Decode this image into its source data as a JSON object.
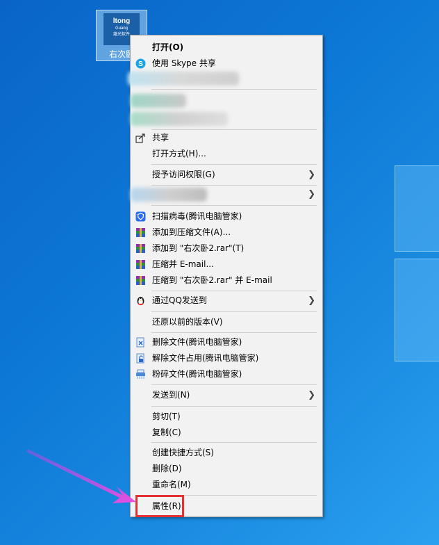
{
  "desktop": {
    "icon_label": "右次卧",
    "icon_logo_title": "ltong",
    "icon_logo_sub": "Guang",
    "icon_logo_tag": "蔻光软件"
  },
  "menu": {
    "open": "打开(O)",
    "skype_share": "使用 Skype 共享",
    "share": "共享",
    "open_with": "打开方式(H)...",
    "grant_access": "授予访问权限(G)",
    "scan_virus": "扫描病毒(腾讯电脑管家)",
    "add_to_archive": "添加到压缩文件(A)...",
    "add_to_rar": "添加到 \"右次卧2.rar\"(T)",
    "compress_email": "压缩并 E-mail...",
    "compress_rar_email": "压缩到 \"右次卧2.rar\" 并 E-mail",
    "send_qq": "通过QQ发送到",
    "restore_previous": "还原以前的版本(V)",
    "delete_file_tencent": "删除文件(腾讯电脑管家)",
    "unlock_file": "解除文件占用(腾讯电脑管家)",
    "shred_file": "粉碎文件(腾讯电脑管家)",
    "send_to": "发送到(N)",
    "cut": "剪切(T)",
    "copy": "复制(C)",
    "create_shortcut": "创建快捷方式(S)",
    "delete": "删除(D)",
    "rename": "重命名(M)",
    "properties": "属性(R)"
  },
  "colors": {
    "desktop_bg": "#0d78d6",
    "menu_bg": "#f2f2f2",
    "highlight_box": "#e53131",
    "pointer_arrow": "#e84fe0"
  }
}
